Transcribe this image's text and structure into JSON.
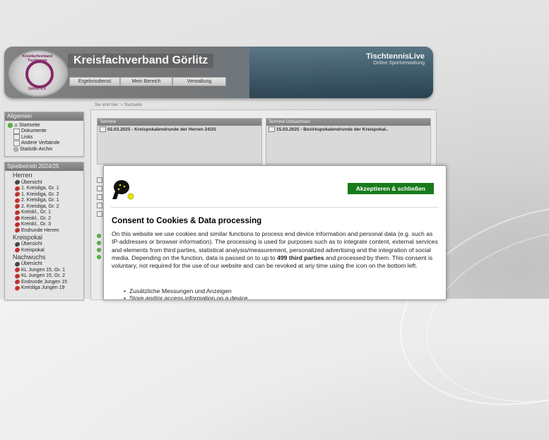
{
  "header": {
    "site_title": "Kreisfachverband Görlitz",
    "brand_name": "TischtennisLive",
    "brand_sub": "Online Sportverwaltung",
    "logo_text_top": "Kreisfachverband Tischtennis",
    "logo_text_bottom": "Görlitz e.V.",
    "nav": [
      "Ergebnisdienst",
      "Mein Bereich",
      "Verwaltung"
    ]
  },
  "sidebar": {
    "allgemein_title": "Allgemein",
    "allgemein_items": [
      "Startseite",
      "Dokumente",
      "Links",
      "Andere Verbände",
      "Statistik-Archiv"
    ],
    "spielbetrieb_title": "Spielbetrieb 2024/25",
    "groups": [
      {
        "name": "Herren",
        "items": [
          "Übersicht",
          "1. Kreisliga, Gr. 1",
          "1. Kreisliga, Gr. 2",
          "2. Kreisliga, Gr. 1",
          "2. Kreisliga, Gr. 2",
          "Kreiskl., Gr. 1",
          "Kreiskl., Gr. 2",
          "Kreiskl., Gr. 3",
          "Endrunde Herren"
        ]
      },
      {
        "name": "Kreispokal",
        "items": [
          "Übersicht",
          "Kreispokal"
        ]
      },
      {
        "name": "Nachwuchs",
        "items": [
          "Übersicht",
          "KL Jungen 15, Gr. 1",
          "KL Jungen 15, Gr. 2",
          "Endrunde Jungen 15",
          "Kreisliga Jungen 19"
        ]
      }
    ]
  },
  "breadcrumb": "Sie sind hier: > Startseite",
  "main": {
    "panel_left": {
      "title": "Termine",
      "row": "02.03.2025 - Kreispokalendrunde der Herren 24/25"
    },
    "panel_right": {
      "title": "Termine Ostsachsen",
      "row": "15.03.2025 - Bezirkspokalendrunde der Kreispokal.."
    }
  },
  "consent": {
    "accept_label": "Akzeptieren & schließen",
    "title": "Consent to Cookies & Data processing",
    "body_1": "On this website we use cookies and similar functions to process end device information and personal data (e.g. such as IP-addresses or browser information). The processing is used for purposes such as to integrate content, external services and elements from third parties, statistical analysis/measurement, personalized advertising and the integration of social media. Depending on the function, data is passed on to up to ",
    "body_bold": "499 third parties",
    "body_2": " and processed by them. This consent is voluntary, not required for the use of our website and can be revoked at any time using the icon on the bottom left.",
    "list": [
      "Zusätzliche Messungen und Anzeigen",
      "Store and/or access information on a device"
    ]
  },
  "colors": {
    "accept_green": "#1a7a1a",
    "sidebar_header": "#8a8a8a"
  }
}
